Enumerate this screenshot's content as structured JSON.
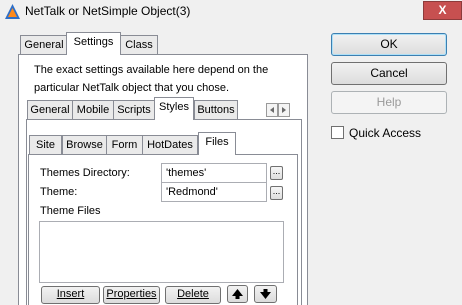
{
  "window": {
    "title": "NetTalk or NetSimple Object(3)",
    "close_glyph": "X"
  },
  "outer_tabs": [
    {
      "label": "General"
    },
    {
      "label": "Settings"
    },
    {
      "label": "Class"
    }
  ],
  "description": {
    "line1": "The exact settings available here depend on the",
    "line2": "particular NetTalk object that you chose."
  },
  "mid_tabs": [
    {
      "label": "General"
    },
    {
      "label": "Mobile"
    },
    {
      "label": "Scripts"
    },
    {
      "label": "Styles"
    },
    {
      "label": "Buttons"
    }
  ],
  "low_tabs": [
    {
      "label": "Site"
    },
    {
      "label": "Browse"
    },
    {
      "label": "Form"
    },
    {
      "label": "HotDates"
    },
    {
      "label": "Files"
    }
  ],
  "files": {
    "themes_directory_label": "Themes Directory:",
    "themes_directory_value": "'themes'",
    "theme_label": "Theme:",
    "theme_value": "'Redmond'",
    "theme_files_label": "Theme Files",
    "ellipsis": "...",
    "insert_label": "Insert",
    "properties_label": "Properties",
    "delete_label": "Delete"
  },
  "side_buttons": {
    "ok": "OK",
    "cancel": "Cancel",
    "help": "Help"
  },
  "quick_access": {
    "label": "Quick Access",
    "checked": false
  },
  "icons": [
    "app-icon",
    "close-icon",
    "scroll-left-icon",
    "scroll-right-icon",
    "move-up-icon",
    "move-down-icon"
  ]
}
